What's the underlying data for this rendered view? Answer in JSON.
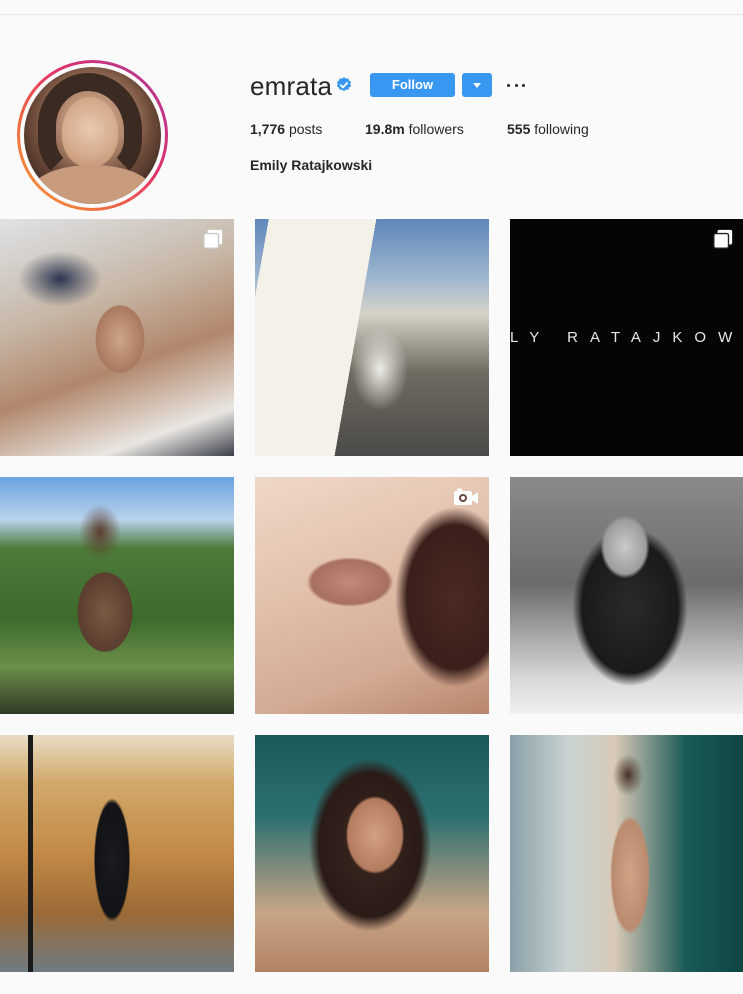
{
  "profile": {
    "username": "emrata",
    "verified": true,
    "follow_label": "Follow",
    "full_name": "Emily Ratajkowski",
    "stats": {
      "posts_count": "1,776",
      "posts_label": "posts",
      "followers_count": "19.8m",
      "followers_label": "followers",
      "following_count": "555",
      "following_label": "following"
    }
  },
  "icons": {
    "verified": "verified-badge-icon",
    "dropdown": "chevron-down-icon",
    "more": "more-options-icon",
    "carousel": "carousel-icon",
    "video": "video-camera-icon"
  },
  "colors": {
    "accent": "#3897f0",
    "verified": "#3897f0",
    "text": "#262626",
    "background": "#fafafa"
  },
  "posts": [
    {
      "type": "carousel"
    },
    {
      "type": "image"
    },
    {
      "type": "carousel",
      "text": "LY RATAJKOW"
    },
    {
      "type": "image"
    },
    {
      "type": "video"
    },
    {
      "type": "image"
    },
    {
      "type": "image"
    },
    {
      "type": "image"
    },
    {
      "type": "image"
    }
  ]
}
